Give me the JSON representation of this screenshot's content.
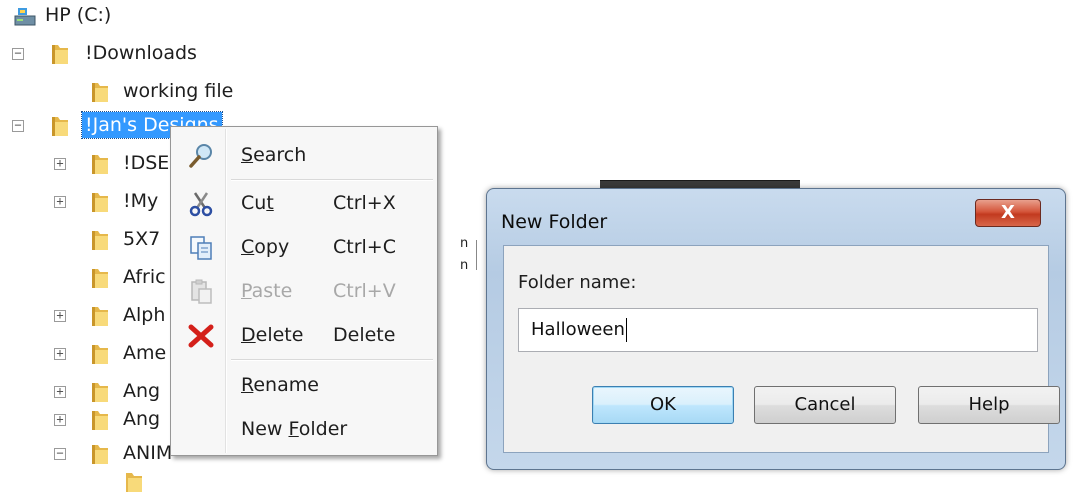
{
  "tree": {
    "drive_label": "HP (C:)",
    "items": [
      {
        "label": "!Downloads",
        "expander": "−"
      },
      {
        "label": "working file",
        "expander": ""
      },
      {
        "label": "!Jan's Designs",
        "expander": "−",
        "selected": true
      },
      {
        "label": "!DSE",
        "expander": "+"
      },
      {
        "label": "!My",
        "expander": "+"
      },
      {
        "label": "5X7",
        "expander": ""
      },
      {
        "label": "Afric",
        "expander": ""
      },
      {
        "label": "Alph",
        "expander": "+"
      },
      {
        "label": "Ame",
        "expander": "+"
      },
      {
        "label": "Ang",
        "expander": "+"
      },
      {
        "label": "Ang",
        "expander": "+"
      },
      {
        "label": "ANIM",
        "expander": "−"
      }
    ]
  },
  "context_menu": {
    "items": [
      {
        "label": "Search",
        "underline": "S",
        "rest": "earch",
        "shortcut": "",
        "icon": "magnifier-icon"
      },
      {
        "label": "Cut",
        "pre": "Cu",
        "underline": "t",
        "shortcut": "Ctrl+X",
        "icon": "scissors-icon"
      },
      {
        "label": "Copy",
        "underline": "C",
        "rest": "opy",
        "shortcut": "Ctrl+C",
        "icon": "copy-icon"
      },
      {
        "label": "Paste",
        "underline": "P",
        "rest": "aste",
        "shortcut": "Ctrl+V",
        "icon": "paste-icon",
        "disabled": true
      },
      {
        "label": "Delete",
        "underline": "D",
        "rest": "elete",
        "shortcut": "Delete",
        "icon": "delete-x-icon"
      },
      {
        "label": "Rename",
        "underline": "R",
        "rest": "ename",
        "shortcut": "",
        "icon": ""
      },
      {
        "label": "New Folder",
        "pre": "New ",
        "underline": "F",
        "rest": "older",
        "shortcut": "",
        "icon": ""
      }
    ]
  },
  "dialog": {
    "title": "New Folder",
    "close_label": "X",
    "field_label": "Folder name:",
    "field_value": "Halloween",
    "buttons": {
      "ok": "OK",
      "cancel": "Cancel",
      "help": "Help"
    }
  },
  "background": {
    "fragment_1": "n",
    "fragment_2": "n"
  },
  "colors": {
    "selection": "#3399ff",
    "close_button": "#c9452a",
    "default_button_border": "#3c7fb1"
  }
}
